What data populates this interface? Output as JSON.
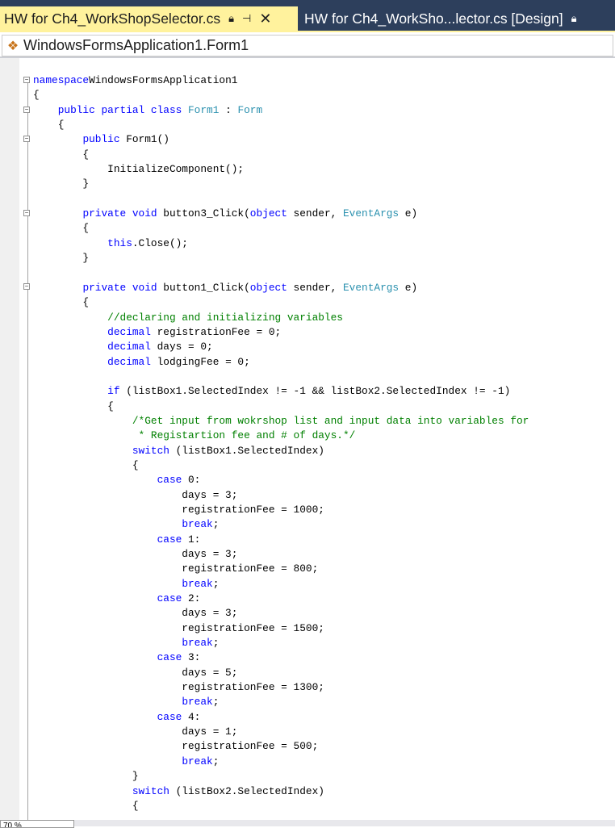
{
  "tabs": [
    {
      "label": "HW for Ch4_WorkShopSelector.cs",
      "active": true
    },
    {
      "label": "HW for Ch4_WorkSho...lector.cs [Design]",
      "active": false
    }
  ],
  "nav": {
    "class_selector": "WindowsFormsApplication1.Form1"
  },
  "zoom": "70 %",
  "code": [
    [
      [
        "kw",
        "namespace"
      ],
      [
        "",
        "WindowsFormsApplication1"
      ]
    ],
    [
      [
        "",
        "{"
      ]
    ],
    [
      [
        "",
        "    "
      ],
      [
        "kw",
        "public partial class "
      ],
      [
        "ty",
        "Form1"
      ],
      [
        "",
        " : "
      ],
      [
        "ty",
        "Form"
      ]
    ],
    [
      [
        "",
        "    {"
      ]
    ],
    [
      [
        "",
        "        "
      ],
      [
        "kw",
        "public "
      ],
      [
        "",
        "Form1()"
      ]
    ],
    [
      [
        "",
        "        {"
      ]
    ],
    [
      [
        "",
        "            InitializeComponent();"
      ]
    ],
    [
      [
        "",
        "        }"
      ]
    ],
    [
      [
        "",
        ""
      ]
    ],
    [
      [
        "",
        "        "
      ],
      [
        "kw",
        "private void "
      ],
      [
        "",
        "button3_Click("
      ],
      [
        "kw",
        "object"
      ],
      [
        "",
        " sender, "
      ],
      [
        "ty",
        "EventArgs"
      ],
      [
        "",
        " e)"
      ]
    ],
    [
      [
        "",
        "        {"
      ]
    ],
    [
      [
        "",
        "            "
      ],
      [
        "kw",
        "this"
      ],
      [
        "",
        ".Close();"
      ]
    ],
    [
      [
        "",
        "        }"
      ]
    ],
    [
      [
        "",
        ""
      ]
    ],
    [
      [
        "",
        "        "
      ],
      [
        "kw",
        "private void "
      ],
      [
        "",
        "button1_Click("
      ],
      [
        "kw",
        "object"
      ],
      [
        "",
        " sender, "
      ],
      [
        "ty",
        "EventArgs"
      ],
      [
        "",
        " e)"
      ]
    ],
    [
      [
        "",
        "        {"
      ]
    ],
    [
      [
        "",
        "            "
      ],
      [
        "cm",
        "//declaring and initializing variables"
      ]
    ],
    [
      [
        "",
        "            "
      ],
      [
        "kw",
        "decimal"
      ],
      [
        "",
        " registrationFee = 0;"
      ]
    ],
    [
      [
        "",
        "            "
      ],
      [
        "kw",
        "decimal"
      ],
      [
        "",
        " days = 0;"
      ]
    ],
    [
      [
        "",
        "            "
      ],
      [
        "kw",
        "decimal"
      ],
      [
        "",
        " lodgingFee = 0;"
      ]
    ],
    [
      [
        "",
        ""
      ]
    ],
    [
      [
        "",
        "            "
      ],
      [
        "kw",
        "if"
      ],
      [
        "",
        " (listBox1.SelectedIndex != -1 && listBox2.SelectedIndex != -1)"
      ]
    ],
    [
      [
        "",
        "            {"
      ]
    ],
    [
      [
        "",
        "                "
      ],
      [
        "cm",
        "/*Get input from wokrshop list and input data into variables for"
      ]
    ],
    [
      [
        "",
        "                "
      ],
      [
        "cm",
        " * Registartion fee and # of days.*/"
      ]
    ],
    [
      [
        "",
        "                "
      ],
      [
        "kw",
        "switch"
      ],
      [
        "",
        " (listBox1.SelectedIndex)"
      ]
    ],
    [
      [
        "",
        "                {"
      ]
    ],
    [
      [
        "",
        "                    "
      ],
      [
        "kw",
        "case"
      ],
      [
        "",
        " 0:"
      ]
    ],
    [
      [
        "",
        "                        days = 3;"
      ]
    ],
    [
      [
        "",
        "                        registrationFee = 1000;"
      ]
    ],
    [
      [
        "",
        "                        "
      ],
      [
        "kw",
        "break"
      ],
      [
        "",
        ";"
      ]
    ],
    [
      [
        "",
        "                    "
      ],
      [
        "kw",
        "case"
      ],
      [
        "",
        " 1:"
      ]
    ],
    [
      [
        "",
        "                        days = 3;"
      ]
    ],
    [
      [
        "",
        "                        registrationFee = 800;"
      ]
    ],
    [
      [
        "",
        "                        "
      ],
      [
        "kw",
        "break"
      ],
      [
        "",
        ";"
      ]
    ],
    [
      [
        "",
        "                    "
      ],
      [
        "kw",
        "case"
      ],
      [
        "",
        " 2:"
      ]
    ],
    [
      [
        "",
        "                        days = 3;"
      ]
    ],
    [
      [
        "",
        "                        registrationFee = 1500;"
      ]
    ],
    [
      [
        "",
        "                        "
      ],
      [
        "kw",
        "break"
      ],
      [
        "",
        ";"
      ]
    ],
    [
      [
        "",
        "                    "
      ],
      [
        "kw",
        "case"
      ],
      [
        "",
        " 3:"
      ]
    ],
    [
      [
        "",
        "                        days = 5;"
      ]
    ],
    [
      [
        "",
        "                        registrationFee = 1300;"
      ]
    ],
    [
      [
        "",
        "                        "
      ],
      [
        "kw",
        "break"
      ],
      [
        "",
        ";"
      ]
    ],
    [
      [
        "",
        "                    "
      ],
      [
        "kw",
        "case"
      ],
      [
        "",
        " 4:"
      ]
    ],
    [
      [
        "",
        "                        days = 1;"
      ]
    ],
    [
      [
        "",
        "                        registrationFee = 500;"
      ]
    ],
    [
      [
        "",
        "                        "
      ],
      [
        "kw",
        "break"
      ],
      [
        "",
        ";"
      ]
    ],
    [
      [
        "",
        "                }"
      ]
    ],
    [
      [
        "",
        "                "
      ],
      [
        "kw",
        "switch"
      ],
      [
        "",
        " (listBox2.SelectedIndex)"
      ]
    ],
    [
      [
        "",
        "                {"
      ]
    ]
  ]
}
